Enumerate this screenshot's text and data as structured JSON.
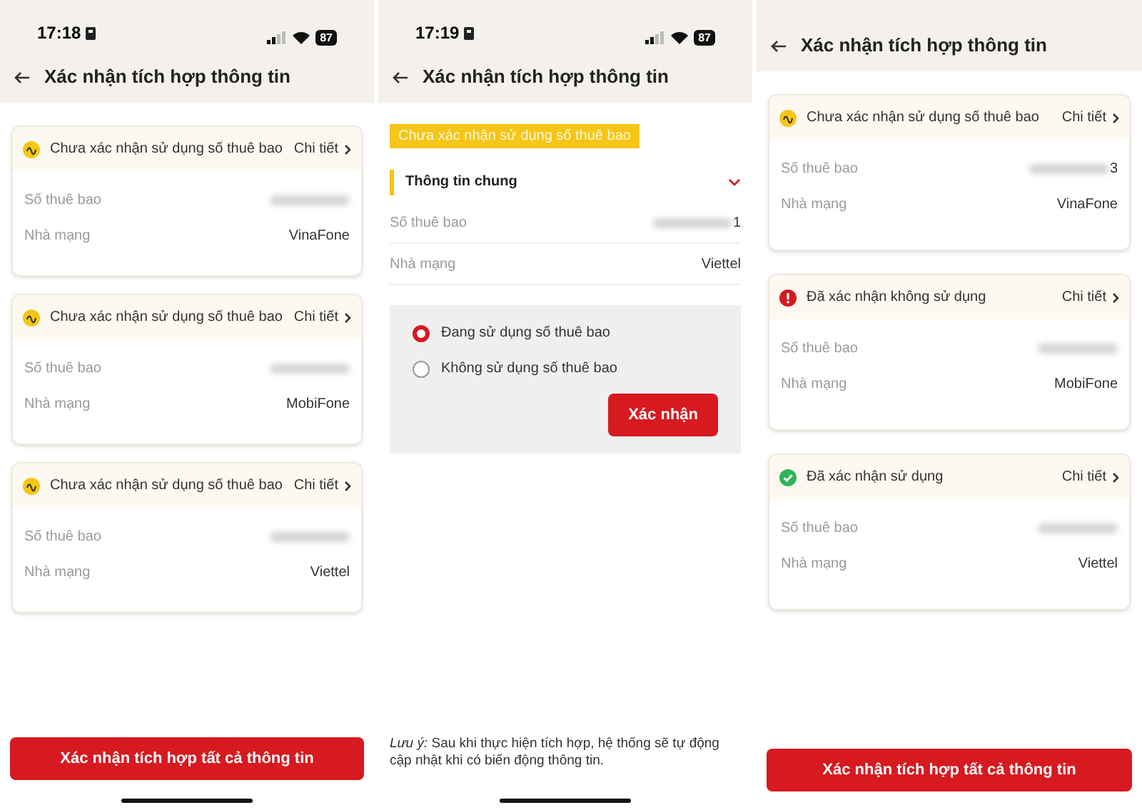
{
  "screens": [
    {
      "status_bar": {
        "time": "17:18",
        "battery": "87"
      },
      "title": "Xác nhận tích hợp thông tin",
      "cards": [
        {
          "kind": "pending",
          "status": "Chưa xác nhận sử dụng số thuê bao",
          "detail": "Chi tiết",
          "rows": [
            {
              "label": "Số thuê bao",
              "kind": "hidden"
            },
            {
              "label": "Nhà mạng",
              "value": "VinaFone"
            }
          ]
        },
        {
          "kind": "pending",
          "status": "Chưa xác nhận sử dụng số thuê bao",
          "detail": "Chi tiết",
          "rows": [
            {
              "label": "Số thuê bao",
              "kind": "hidden"
            },
            {
              "label": "Nhà mạng",
              "value": "MobiFone"
            }
          ]
        },
        {
          "kind": "pending",
          "status": "Chưa xác nhận sử dụng số thuê bao",
          "detail": "Chi tiết",
          "rows": [
            {
              "label": "Số thuê bao",
              "kind": "hidden"
            },
            {
              "label": "Nhà mạng",
              "value": "Viettel"
            }
          ]
        }
      ],
      "button": "Xác nhận tích hợp tất cả thông tin"
    },
    {
      "status_bar": {
        "time": "17:19",
        "battery": "87"
      },
      "title": "Xác nhận tích hợp thông tin",
      "tag": "Chưa xác nhận sử dụng số thuê bao",
      "section": {
        "title": "Thông tin chung",
        "expanded": true,
        "rows": [
          {
            "label": "Số thuê bao",
            "kind": "hidden",
            "tail": "1"
          },
          {
            "label": "Nhà mạng",
            "value": "Viettel"
          }
        ]
      },
      "options": [
        {
          "label": "Đang sử dụng số thuê bao",
          "selected": true
        },
        {
          "label": "Không sử dụng số thuê bao",
          "selected": false
        }
      ],
      "confirm": "Xác nhận",
      "note": "*Lưu ý:* Sau khi thực hiện tích hợp, hệ thống sẽ tự động cập nhật khi có biến động thông tin."
    },
    {
      "title": "Xác nhận tích hợp thông tin",
      "cards": [
        {
          "kind": "pending",
          "status": "Chưa xác nhận sử dụng số thuê bao",
          "detail": "Chi tiết",
          "rows": [
            {
              "label": "Số thuê bao",
              "kind": "hidden",
              "tail": "3"
            },
            {
              "label": "Nhà mạng",
              "value": "VinaFone"
            }
          ]
        },
        {
          "kind": "rejected",
          "status": "Đã xác nhận không sử dụng",
          "detail": "Chi tiết",
          "rows": [
            {
              "label": "Số thuê bao",
              "kind": "hidden"
            },
            {
              "label": "Nhà mạng",
              "value": "MobiFone"
            }
          ]
        },
        {
          "kind": "confirmed",
          "status": "Đã xác nhận sử dụng",
          "detail": "Chi tiết",
          "rows": [
            {
              "label": "Số thuê bao",
              "kind": "hidden"
            },
            {
              "label": "Nhà mạng",
              "value": "Viettel"
            }
          ]
        }
      ],
      "button": "Xác nhận tích hợp tất cả thông tin"
    }
  ]
}
